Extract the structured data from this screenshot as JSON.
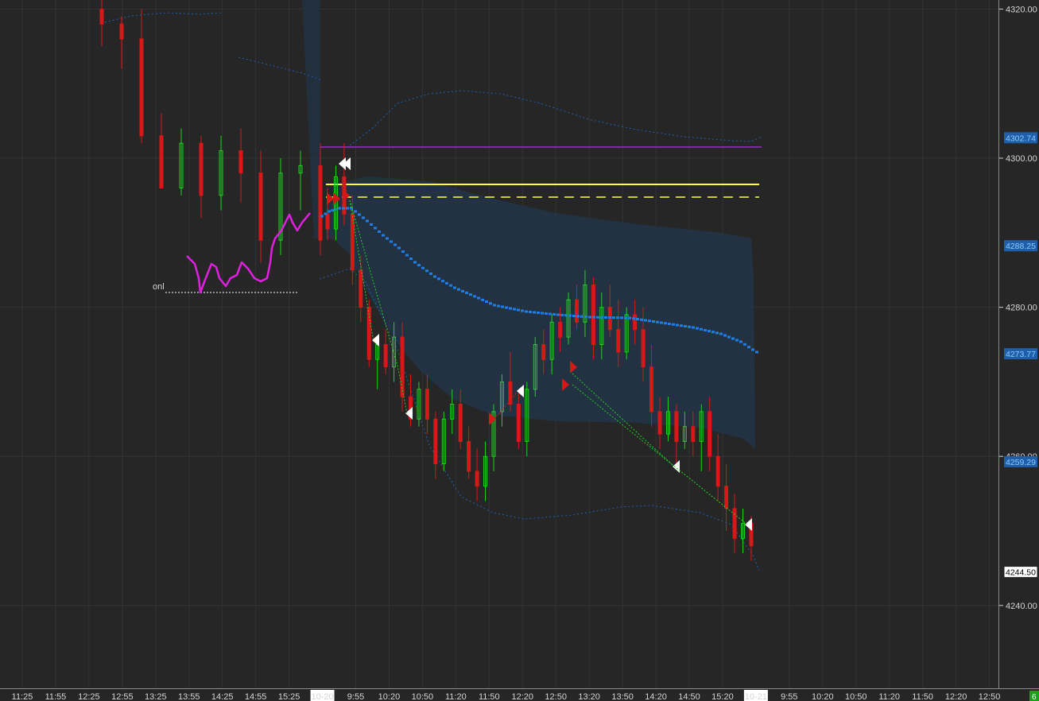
{
  "colors": {
    "background": "#262626",
    "grid": "#333333",
    "bull": "#1fd21f",
    "bear": "#d81818",
    "vwap": "#1e7ee6",
    "band": "#1d60b0",
    "cloud": "#223446",
    "yellow": "#ffff33",
    "purple": "#7a2ca0",
    "magenta": "#e020e0",
    "white": "#ffffff",
    "badge_blue": "#1d5fa8",
    "badge_green": "#1aa01a"
  },
  "annotation_text": "onl",
  "corner_badge": "6",
  "chart_data": {
    "type": "candlestick",
    "ylim": [
      4222,
      4321
    ],
    "y_ticks": [
      4320,
      4300,
      4280,
      4260,
      4240
    ],
    "y_tick_labels": [
      "4320.00",
      "4300.00",
      "4280.00",
      "4260.00",
      "4240.00"
    ],
    "price_markers": [
      {
        "label": "4302.74",
        "value": 4302.74,
        "style": "blue"
      },
      {
        "label": "4288.25",
        "value": 4288.25,
        "style": "blue"
      },
      {
        "label": "4273.77",
        "value": 4273.77,
        "style": "blue"
      },
      {
        "label": "4259.29",
        "value": 4259.29,
        "style": "blue"
      },
      {
        "label": "4244.50",
        "value": 4244.5,
        "style": "white"
      }
    ],
    "x_labels": [
      "11:25",
      "11:55",
      "12:25",
      "12:55",
      "13:25",
      "13:55",
      "14:25",
      "14:55",
      "15:25",
      "10-20",
      "9:55",
      "10:20",
      "10:50",
      "11:20",
      "11:50",
      "12:20",
      "12:50",
      "13:20",
      "13:50",
      "14:20",
      "14:50",
      "15:20",
      "10-21",
      "9:55",
      "10:20",
      "10:50",
      "11:20",
      "11:50",
      "12:20",
      "12:50"
    ],
    "x_label_highlight": [
      "10-20",
      "10-21"
    ],
    "session_1_candles": [
      [
        4320,
        4322,
        4315,
        4318
      ],
      [
        4318,
        4319,
        4312,
        4316
      ],
      [
        4316,
        4320,
        4302,
        4303
      ],
      [
        4303,
        4306,
        4296,
        4296
      ],
      [
        4296,
        4304,
        4295,
        4302
      ],
      [
        4302,
        4303,
        4292,
        4295
      ],
      [
        4295,
        4303,
        4293,
        4301
      ],
      [
        4301,
        4304,
        4294,
        4298
      ],
      [
        4298,
        4301,
        4286,
        4289
      ],
      [
        4289,
        4300,
        4287,
        4298
      ],
      [
        4298,
        4301,
        4293,
        4299
      ],
      [
        4299,
        4302,
        4287,
        4289
      ]
    ],
    "session_2_candles": [
      [
        4292.5,
        4296,
        4289,
        4290.5
      ],
      [
        4290.5,
        4299,
        4289,
        4297.5
      ],
      [
        4297.5,
        4302,
        4291,
        4292.5
      ],
      [
        4292.5,
        4295,
        4283,
        4285
      ],
      [
        4285,
        4287,
        4278,
        4280
      ],
      [
        4280,
        4281,
        4272,
        4273
      ],
      [
        4273,
        4276,
        4269,
        4275
      ],
      [
        4275,
        4277,
        4271,
        4272
      ],
      [
        4272,
        4278,
        4270,
        4276
      ],
      [
        4276,
        4278,
        4266,
        4268
      ],
      [
        4268,
        4271,
        4264,
        4265
      ],
      [
        4265,
        4270,
        4264,
        4269
      ],
      [
        4269,
        4271,
        4263,
        4265
      ],
      [
        4265,
        4266,
        4257,
        4259
      ],
      [
        4259,
        4266,
        4258,
        4265
      ],
      [
        4265,
        4269,
        4263,
        4267
      ],
      [
        4267,
        4269,
        4261,
        4262
      ],
      [
        4262,
        4264,
        4257,
        4258
      ],
      [
        4258,
        4261,
        4254,
        4256
      ],
      [
        4256,
        4262,
        4254,
        4260
      ],
      [
        4260,
        4267,
        4258,
        4266
      ],
      [
        4266,
        4271,
        4264,
        4270
      ],
      [
        4270,
        4274,
        4266,
        4267
      ],
      [
        4267,
        4269,
        4261,
        4262
      ],
      [
        4262,
        4270,
        4260,
        4269
      ],
      [
        4269,
        4276,
        4268,
        4275
      ],
      [
        4275,
        4277,
        4271,
        4273
      ],
      [
        4273,
        4279,
        4271,
        4278
      ],
      [
        4278,
        4280,
        4274,
        4276
      ],
      [
        4276,
        4282,
        4275,
        4281
      ],
      [
        4281,
        4283,
        4277,
        4278
      ],
      [
        4278,
        4285,
        4276,
        4283
      ],
      [
        4283,
        4284,
        4273,
        4275
      ],
      [
        4275,
        4282,
        4273,
        4280
      ],
      [
        4280,
        4283,
        4276,
        4277
      ],
      [
        4277,
        4281,
        4272,
        4274
      ],
      [
        4274,
        4280,
        4273,
        4279
      ],
      [
        4279,
        4281,
        4275,
        4277
      ],
      [
        4277,
        4280,
        4270,
        4272
      ],
      [
        4272,
        4275,
        4264,
        4266
      ],
      [
        4266,
        4268,
        4261,
        4263
      ],
      [
        4263,
        4268,
        4262,
        4266
      ],
      [
        4266,
        4267,
        4259,
        4262
      ],
      [
        4262,
        4266,
        4261,
        4264
      ],
      [
        4264,
        4266,
        4260,
        4262
      ],
      [
        4262,
        4267,
        4258,
        4266
      ],
      [
        4266,
        4268,
        4258,
        4260
      ],
      [
        4260,
        4263,
        4254,
        4256
      ],
      [
        4256,
        4259,
        4250,
        4253
      ],
      [
        4253,
        4255,
        4247,
        4249
      ],
      [
        4249,
        4253,
        4247,
        4251
      ],
      [
        4251,
        4252,
        4246,
        4248
      ]
    ]
  }
}
